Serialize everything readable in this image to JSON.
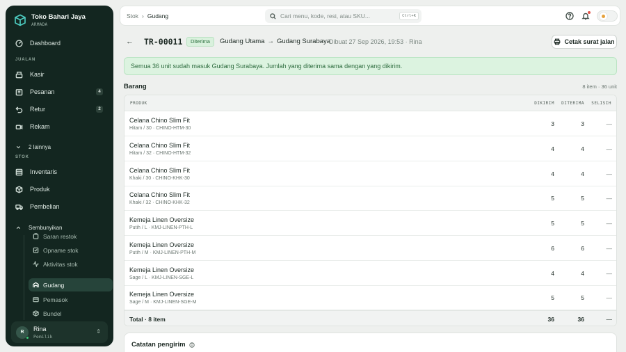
{
  "brand": {
    "name": "Toko Bahari Jaya",
    "sub": "ARMADA"
  },
  "sidebar": {
    "dashboard": "Dashboard",
    "section_jualan": "JUALAN",
    "kasir": "Kasir",
    "pesanan": "Pesanan",
    "pesanan_badge": "4",
    "retur": "Retur",
    "retur_badge": "2",
    "rekam": "Rekam",
    "more": "2 lainnya",
    "section_stok": "STOK",
    "inventaris": "Inventaris",
    "produk": "Produk",
    "pembelian": "Pembelian",
    "sembunyikan": "Sembunyikan",
    "sub": {
      "saran_restok": "Saran restok",
      "opname_stok": "Opname stok",
      "aktivitas_stok": "Aktivitas stok",
      "gudang": "Gudang",
      "pemasok": "Pemasok",
      "bundel": "Bundel"
    }
  },
  "user": {
    "initial": "R",
    "name": "Rina",
    "role": "Pemilik"
  },
  "topbar": {
    "crumb_parent": "Stok",
    "crumb_sep": "›",
    "crumb_current": "Gudang",
    "search_placeholder": "Cari menu, kode, resi, atau SKU...",
    "shortcut": "Ctrl+K"
  },
  "header": {
    "doc_id": "TR-00011",
    "status": "Diterima",
    "from": "Gudang Utama",
    "arrow": "→",
    "to": "Gudang Surabaya",
    "meta": "Dibuat 27 Sep 2026, 19:53 · Rina",
    "print_label": "Cetak surat jalan"
  },
  "alert": "Semua 36 unit sudah masuk Gudang Surabaya. Jumlah yang diterima sama dengan yang dikirim.",
  "items_section": {
    "title": "Barang",
    "count": "8 item · 36 unit"
  },
  "table": {
    "headers": {
      "produk": "PRODUK",
      "dikirim": "DIKIRIM",
      "diterima": "DITERIMA",
      "selisih": "SELISIH"
    },
    "rows": [
      {
        "name": "Celana Chino Slim Fit",
        "variant": "Hitam / 30 · CHINO-HTM-30",
        "dikirim": "3",
        "diterima": "3",
        "selisih": "—"
      },
      {
        "name": "Celana Chino Slim Fit",
        "variant": "Hitam / 32 · CHINO-HTM-32",
        "dikirim": "4",
        "diterima": "4",
        "selisih": "—"
      },
      {
        "name": "Celana Chino Slim Fit",
        "variant": "Khaki / 30 · CHINO-KHK-30",
        "dikirim": "4",
        "diterima": "4",
        "selisih": "—"
      },
      {
        "name": "Celana Chino Slim Fit",
        "variant": "Khaki / 32 · CHINO-KHK-32",
        "dikirim": "5",
        "diterima": "5",
        "selisih": "—"
      },
      {
        "name": "Kemeja Linen Oversize",
        "variant": "Putih / L · KMJ-LINEN-PTH-L",
        "dikirim": "5",
        "diterima": "5",
        "selisih": "—"
      },
      {
        "name": "Kemeja Linen Oversize",
        "variant": "Putih / M · KMJ-LINEN-PTH-M",
        "dikirim": "6",
        "diterima": "6",
        "selisih": "—"
      },
      {
        "name": "Kemeja Linen Oversize",
        "variant": "Sage / L · KMJ-LINEN-SGE-L",
        "dikirim": "4",
        "diterima": "4",
        "selisih": "—"
      },
      {
        "name": "Kemeja Linen Oversize",
        "variant": "Sage / M · KMJ-LINEN-SGE-M",
        "dikirim": "5",
        "diterima": "5",
        "selisih": "—"
      }
    ],
    "footer": {
      "label": "Total · 8 item",
      "dikirim": "36",
      "diterima": "36",
      "selisih": "—"
    }
  },
  "notes": {
    "title": "Catatan pengirim"
  }
}
